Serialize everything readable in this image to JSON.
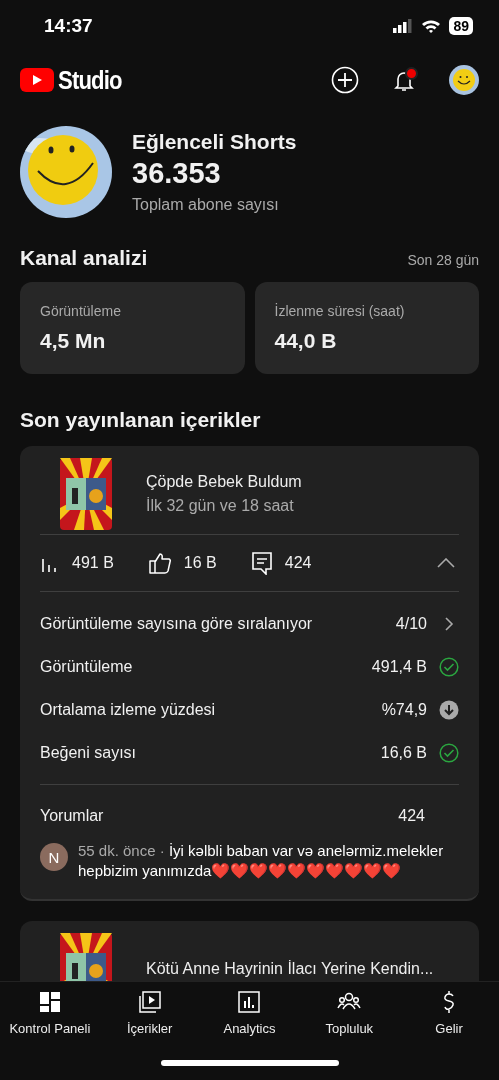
{
  "status_bar": {
    "time": "14:37",
    "battery": "89"
  },
  "header": {
    "logo_text": "Studio",
    "notification_dot": true
  },
  "channel": {
    "name": "Eğlenceli Shorts",
    "subscribers": "36.353",
    "subscribers_label": "Toplam abone sayısı"
  },
  "analytics": {
    "title": "Kanal analizi",
    "period": "Son 28 gün",
    "stats": [
      {
        "label": "Görüntüleme",
        "value": "4,5 Mn"
      },
      {
        "label": "İzlenme süresi (saat)",
        "value": "44,0 B"
      }
    ]
  },
  "recent": {
    "title": "Son yayınlanan içerikler",
    "items": [
      {
        "title": "Çöpde Bebek Buldum",
        "subtitle": "İlk 32 gün ve 18 saat",
        "views": "491 B",
        "likes": "16 B",
        "comments": "424",
        "expanded": true,
        "rows": [
          {
            "kind": "ranking",
            "label": "Görüntüleme sayısına göre sıralanıyor",
            "value": "4/10"
          },
          {
            "kind": "good",
            "label": "Görüntüleme",
            "value": "491,4 B"
          },
          {
            "kind": "below",
            "label": "Ortalama izleme yüzdesi",
            "value": "%74,9"
          },
          {
            "kind": "good",
            "label": "Beğeni sayısı",
            "value": "16,6 B"
          }
        ],
        "comments_label": "Yorumlar",
        "comments_count": "424",
        "comment": {
          "initial": "N",
          "time": "55 dk. önce ·",
          "text": "İyi kəlbli baban var və anelərmiz.melekler hepbizim yanımızda❤️❤️❤️❤️❤️❤️❤️❤️❤️❤️"
        }
      },
      {
        "title": "Kötü Anne Hayrinin İlacı Yerine Kendin..."
      }
    ]
  },
  "nav": [
    {
      "label": "Kontrol Paneli"
    },
    {
      "label": "İçerikler"
    },
    {
      "label": "Analytics"
    },
    {
      "label": "Topluluk"
    },
    {
      "label": "Gelir"
    }
  ]
}
